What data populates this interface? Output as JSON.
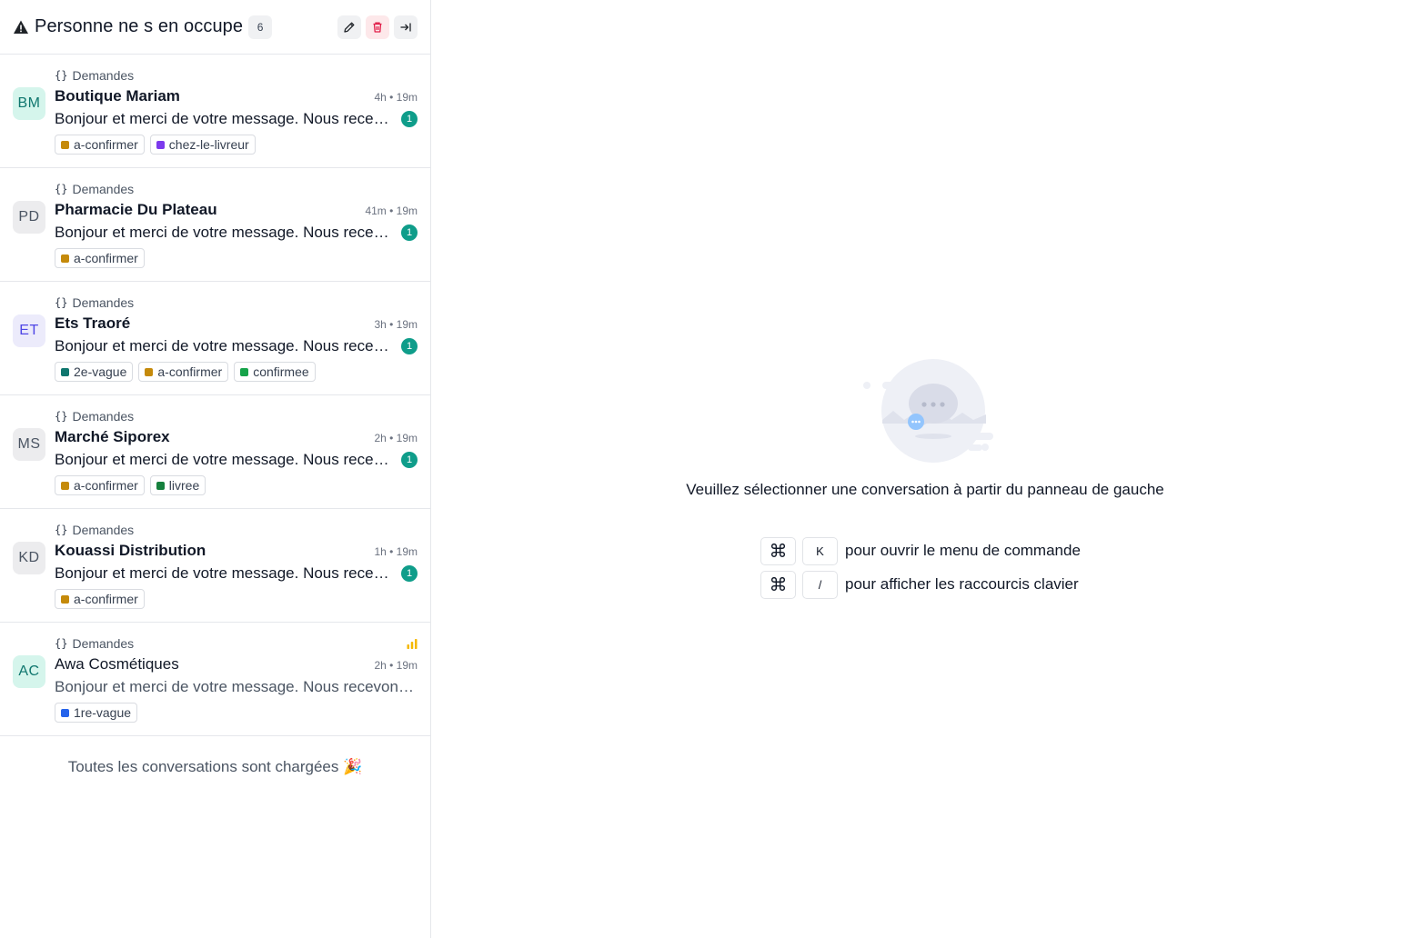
{
  "header": {
    "title": "Personne ne s en occupe",
    "count": "6"
  },
  "conversations": [
    {
      "initials": "BM",
      "avatar_style": "av-teal",
      "inbox": "Demandes",
      "name": "Boutique Mariam",
      "time": "4h • 19m",
      "message": "Bonjour et merci de votre message. Nous recevons votre demande",
      "unread": "1",
      "labels": [
        {
          "text": "a-confirmer",
          "color": "#c58a0a"
        },
        {
          "text": "chez-le-livreur",
          "color": "#7c3aed"
        }
      ]
    },
    {
      "initials": "PD",
      "avatar_style": "av-gray",
      "inbox": "Demandes",
      "name": "Pharmacie Du Plateau",
      "time": "41m • 19m",
      "message": "Bonjour et merci de votre message. Nous recevons votre demande",
      "unread": "1",
      "labels": [
        {
          "text": "a-confirmer",
          "color": "#c58a0a"
        }
      ]
    },
    {
      "initials": "ET",
      "avatar_style": "av-violet",
      "inbox": "Demandes",
      "name": "Ets Traoré",
      "time": "3h • 19m",
      "message": "Bonjour et merci de votre message. Nous recevons votre demande",
      "unread": "1",
      "labels": [
        {
          "text": "2e-vague",
          "color": "#0f766e"
        },
        {
          "text": "a-confirmer",
          "color": "#c58a0a"
        },
        {
          "text": "confirmee",
          "color": "#16a34a"
        }
      ]
    },
    {
      "initials": "MS",
      "avatar_style": "av-gray",
      "inbox": "Demandes",
      "name": "Marché Siporex",
      "time": "2h • 19m",
      "message": "Bonjour et merci de votre message. Nous recevons votre demande",
      "unread": "1",
      "labels": [
        {
          "text": "a-confirmer",
          "color": "#c58a0a"
        },
        {
          "text": "livree",
          "color": "#15803d"
        }
      ]
    },
    {
      "initials": "KD",
      "avatar_style": "av-gray",
      "inbox": "Demandes",
      "name": "Kouassi Distribution",
      "time": "1h • 19m",
      "message": "Bonjour et merci de votre message. Nous recevons votre demande",
      "unread": "1",
      "labels": [
        {
          "text": "a-confirmer",
          "color": "#c58a0a"
        }
      ]
    },
    {
      "initials": "AC",
      "avatar_style": "av-teal",
      "inbox": "Demandes",
      "name": "Awa Cosmétiques",
      "time": "2h • 19m",
      "message": "Bonjour et merci de votre message. Nous recevons votre demande",
      "unread": "",
      "priority": true,
      "labels": [
        {
          "text": "1re-vague",
          "color": "#2563eb"
        }
      ]
    }
  ],
  "end_note": "Toutes les conversations sont chargées 🎉",
  "empty_state": {
    "message": "Veuillez sélectionner une conversation à partir du panneau de gauche",
    "shortcuts": [
      {
        "keys": [
          "⌘",
          "K"
        ],
        "text": "pour ouvrir le menu de commande"
      },
      {
        "keys": [
          "⌘",
          "/"
        ],
        "text": "pour afficher les raccourcis clavier"
      }
    ]
  },
  "colors": {
    "unread_badge": "#0f9d8a",
    "delete_button_bg": "#fde8ea",
    "priority_icon": "#f5b800"
  },
  "icons": {
    "header": "warning-icon",
    "actions": [
      "edit-icon",
      "trash-icon",
      "arrow-right-to-line-icon"
    ],
    "inbox": "braces-icon",
    "priority": "signal-bars-icon"
  }
}
